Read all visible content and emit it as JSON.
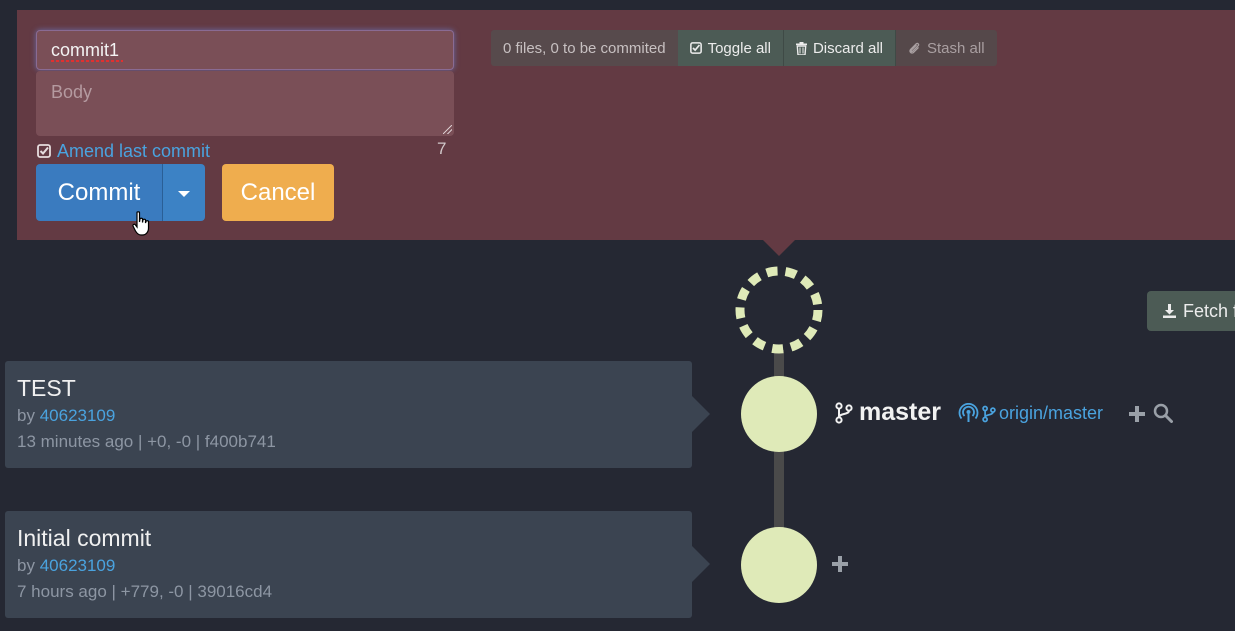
{
  "commit_form": {
    "title_value": "commit1",
    "body_placeholder": "Body",
    "amend_label": "Amend last commit",
    "char_count": "7",
    "commit_label": "Commit",
    "cancel_label": "Cancel"
  },
  "toolbar": {
    "status": "0 files, 0 to be commited",
    "toggle_all": "Toggle all",
    "discard_all": "Discard all",
    "stash_all": "Stash all"
  },
  "fetch": {
    "label": "Fetch f"
  },
  "commits": [
    {
      "title": "TEST",
      "by_prefix": "by",
      "author": "40623109",
      "meta": "13 minutes ago | +0, -0 | f400b741"
    },
    {
      "title": "Initial commit",
      "by_prefix": "by",
      "author": "40623109",
      "meta": "7 hours ago | +779, -0 | 39016cd4"
    }
  ],
  "refs": {
    "local_branch": "master",
    "remote_branch": "origin/master"
  },
  "colors": {
    "background": "#252833",
    "staging_panel": "#633a43",
    "commit_button": "#3a7bbf",
    "cancel_button": "#efad4e",
    "link": "#4aa3df",
    "node": "#dfeab8"
  },
  "icons": [
    "check-square-icon",
    "trash-icon",
    "paperclip-icon",
    "git-branch-icon",
    "broadcast-icon",
    "plus-icon",
    "search-icon",
    "download-icon",
    "caret-down-icon"
  ]
}
